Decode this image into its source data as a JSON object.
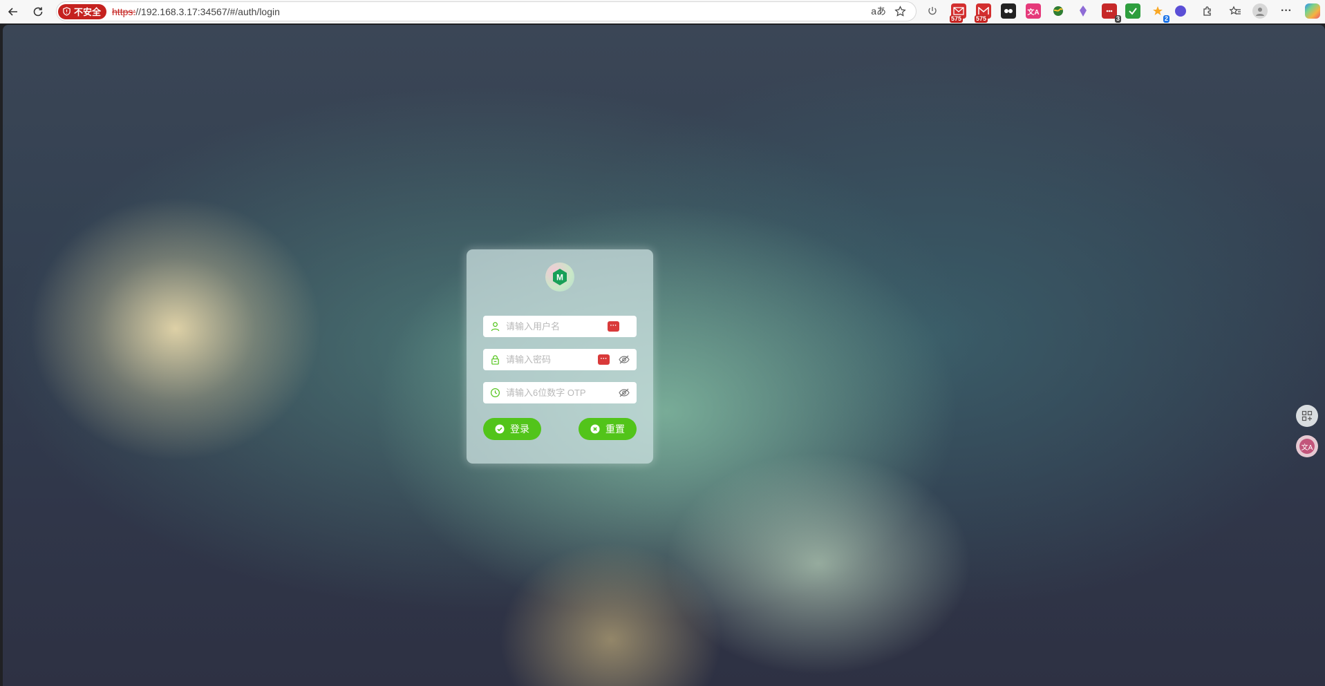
{
  "browser": {
    "insecure_label": "不安全",
    "url_scheme": "https:",
    "url_rest": "//192.168.3.17:34567/#/auth/login",
    "read_aloud_label": "aあ",
    "extensions": [
      {
        "name": "mail-extension",
        "badge": "575",
        "color": "#d32f2f"
      },
      {
        "name": "gmail-extension",
        "badge": "575",
        "color": "#d32f2f"
      },
      {
        "name": "extension-3",
        "badge": "3",
        "color": "#c62828"
      },
      {
        "name": "extension-2",
        "badge": "2",
        "color": "#f9a825"
      }
    ]
  },
  "login": {
    "logo_letter": "M",
    "username_placeholder": "请输入用户名",
    "password_placeholder": "请输入密码",
    "otp_placeholder": "请输入6位数字 OTP",
    "login_label": "登录",
    "reset_label": "重置",
    "accent_color": "#52c41a"
  }
}
